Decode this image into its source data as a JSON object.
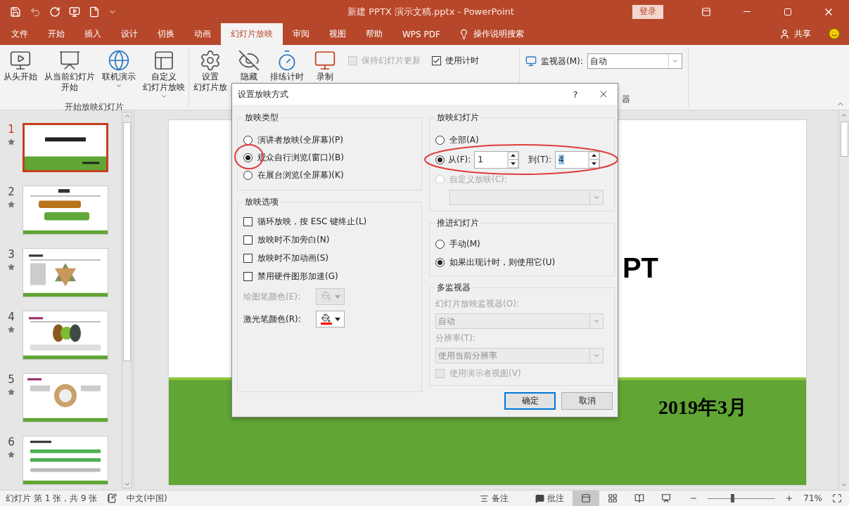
{
  "title_bar": {
    "title": "新建 PPTX 演示文稿.pptx  -  PowerPoint",
    "login": "登录"
  },
  "tabs": [
    {
      "label": "文件",
      "selected": false
    },
    {
      "label": "开始",
      "selected": false
    },
    {
      "label": "插入",
      "selected": false
    },
    {
      "label": "设计",
      "selected": false
    },
    {
      "label": "切换",
      "selected": false
    },
    {
      "label": "动画",
      "selected": false
    },
    {
      "label": "幻灯片放映",
      "selected": true
    },
    {
      "label": "审阅",
      "selected": false
    },
    {
      "label": "视图",
      "selected": false
    },
    {
      "label": "帮助",
      "selected": false
    },
    {
      "label": "WPS PDF",
      "selected": false
    }
  ],
  "tell_me": "操作说明搜索",
  "share": "共享",
  "ribbon": {
    "start_buttons": [
      {
        "lines": [
          "从头开始"
        ],
        "kind": "play",
        "dropdown": false
      },
      {
        "lines": [
          "从当前幻灯片",
          "开始"
        ],
        "kind": "current",
        "dropdown": false
      },
      {
        "lines": [
          "联机演示"
        ],
        "kind": "online",
        "dropdown": true
      },
      {
        "lines": [
          "自定义",
          "幻灯片放映"
        ],
        "kind": "custom",
        "dropdown": true
      }
    ],
    "start_group_label": "开始放映幻灯片",
    "setup_buttons": [
      {
        "lines": [
          "设置",
          "幻灯片放"
        ],
        "kind": "setup"
      },
      {
        "lines": [
          "隐藏"
        ],
        "kind": "hide"
      },
      {
        "lines": [
          "排练计时"
        ],
        "kind": "timer"
      },
      {
        "lines": [
          "录制"
        ],
        "kind": "record"
      }
    ],
    "checkboxes": [
      {
        "label": "保持幻灯片更新",
        "checked": false,
        "disabled": true
      },
      {
        "label": "使用计时",
        "checked": true,
        "disabled": false
      }
    ],
    "monitor": {
      "label": "监视器(M):",
      "value": "自动"
    },
    "monitor_group_label": "器"
  },
  "slides": [
    {
      "number": "1",
      "selected": true
    },
    {
      "number": "2",
      "selected": false
    },
    {
      "number": "3",
      "selected": false
    },
    {
      "number": "4",
      "selected": false
    },
    {
      "number": "5",
      "selected": false
    },
    {
      "number": "6",
      "selected": false
    }
  ],
  "slide": {
    "title": "PT",
    "date": "2019年3月"
  },
  "status_bar": {
    "slide_info": "幻灯片 第 1 张，共 9 张",
    "language": "中文(中国)",
    "notes": "备注",
    "comments": "批注",
    "zoom": {
      "level": 0.36
    },
    "zoom_text": "71%"
  },
  "dialog": {
    "title": "设置放映方式",
    "help": "?",
    "show_type": {
      "title": "放映类型",
      "options": [
        {
          "label": "演讲者放映(全屏幕)(P)",
          "selected": false
        },
        {
          "label": "观众自行浏览(窗口)(B)",
          "selected": true
        },
        {
          "label": "在展台浏览(全屏幕)(K)",
          "selected": false
        }
      ]
    },
    "show_options": {
      "title": "放映选项",
      "options": [
        {
          "label": "循环放映，按 ESC 键终止(L)",
          "checked": false
        },
        {
          "label": "放映时不加旁白(N)",
          "checked": false
        },
        {
          "label": "放映时不加动画(S)",
          "checked": false
        },
        {
          "label": "禁用硬件图形加速(G)",
          "checked": false
        }
      ],
      "pens": [
        {
          "label": "绘图笔颜色(E):",
          "disabled": true,
          "color": "#e0e0e0"
        },
        {
          "label": "激光笔颜色(R):",
          "disabled": false,
          "color": "#ff0000"
        }
      ]
    },
    "show_slides": {
      "title": "放映幻灯片",
      "all": {
        "label": "全部(A)",
        "selected": false
      },
      "range": {
        "selected": true,
        "from_label": "从(F):",
        "from": "1",
        "to_label": "到(T):",
        "to": "4"
      },
      "custom": {
        "label": "自定义放映(C):",
        "selected": false,
        "disabled": true
      }
    },
    "advance": {
      "title": "推进幻灯片",
      "options": [
        {
          "label": "手动(M)",
          "selected": false
        },
        {
          "label": "如果出现计时，则使用它(U)",
          "selected": true
        }
      ]
    },
    "monitors": {
      "title": "多监视器",
      "monitor_label": "幻灯片放映监视器(O):",
      "monitor_value": "自动",
      "resolution_label": "分辨率(T):",
      "resolution_value": "使用当前分辨率",
      "presenter": {
        "label": "使用演示者视图(V)",
        "checked": false,
        "disabled": true
      }
    },
    "ok": "确定",
    "cancel": "取消"
  }
}
